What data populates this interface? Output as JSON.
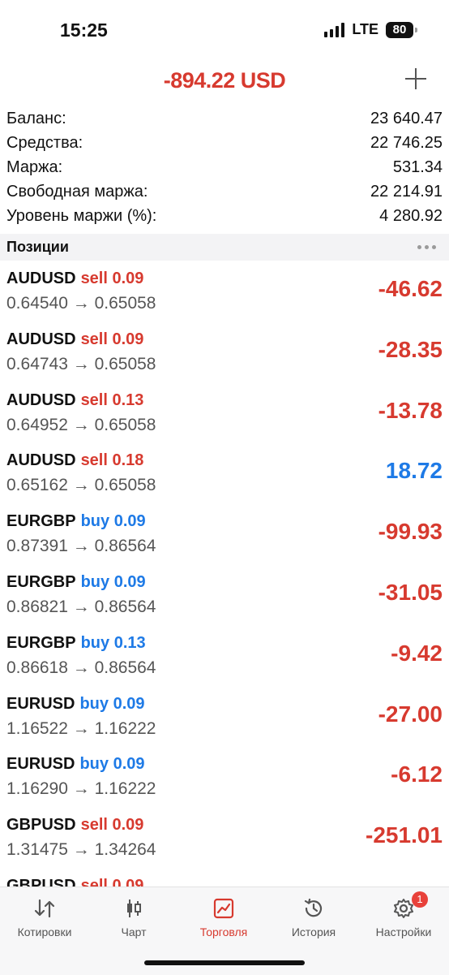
{
  "status": {
    "time": "15:25",
    "network": "LTE",
    "battery": "80"
  },
  "header": {
    "total": "-894.22 USD",
    "add_icon": "plus-icon"
  },
  "summary": [
    {
      "label": "Баланс:",
      "value": "23 640.47"
    },
    {
      "label": "Средства:",
      "value": "22 746.25"
    },
    {
      "label": "Маржа:",
      "value": "531.34"
    },
    {
      "label": "Свободная маржа:",
      "value": "22 214.91"
    },
    {
      "label": "Уровень маржи (%):",
      "value": "4 280.92"
    }
  ],
  "positions": {
    "title": "Позиции",
    "items": [
      {
        "symbol": "AUDUSD",
        "direction": "sell 0.09",
        "prices": "0.64540 → 0.65058",
        "profit": "-46.62"
      },
      {
        "symbol": "AUDUSD",
        "direction": "sell 0.09",
        "prices": "0.64743 → 0.65058",
        "profit": "-28.35"
      },
      {
        "symbol": "AUDUSD",
        "direction": "sell 0.13",
        "prices": "0.64952 → 0.65058",
        "profit": "-13.78"
      },
      {
        "symbol": "AUDUSD",
        "direction": "sell 0.18",
        "prices": "0.65162 → 0.65058",
        "profit": "18.72"
      },
      {
        "symbol": "EURGBP",
        "direction": "buy 0.09",
        "prices": "0.87391 → 0.86564",
        "profit": "-99.93"
      },
      {
        "symbol": "EURGBP",
        "direction": "buy 0.09",
        "prices": "0.86821 → 0.86564",
        "profit": "-31.05"
      },
      {
        "symbol": "EURGBP",
        "direction": "buy 0.13",
        "prices": "0.86618 → 0.86564",
        "profit": "-9.42"
      },
      {
        "symbol": "EURUSD",
        "direction": "buy 0.09",
        "prices": "1.16522 → 1.16222",
        "profit": "-27.00"
      },
      {
        "symbol": "EURUSD",
        "direction": "buy 0.09",
        "prices": "1.16290 → 1.16222",
        "profit": "-6.12"
      },
      {
        "symbol": "GBPUSD",
        "direction": "sell 0.09",
        "prices": "1.31475 → 1.34264",
        "profit": "-251.01"
      },
      {
        "symbol": "GBPUSD",
        "direction": "sell 0.09",
        "prices": "",
        "profit": ""
      }
    ]
  },
  "tabs": [
    {
      "label": "Котировки",
      "icon": "quotes-icon"
    },
    {
      "label": "Чарт",
      "icon": "chart-icon"
    },
    {
      "label": "Торговля",
      "icon": "trade-icon",
      "active": true
    },
    {
      "label": "История",
      "icon": "history-icon"
    },
    {
      "label": "Настройки",
      "icon": "settings-icon",
      "badge": "1"
    }
  ],
  "colors": {
    "loss": "#d73a2f",
    "profit": "#1e7ae6",
    "sell": "#d73a2f",
    "buy": "#1e7ae6"
  }
}
